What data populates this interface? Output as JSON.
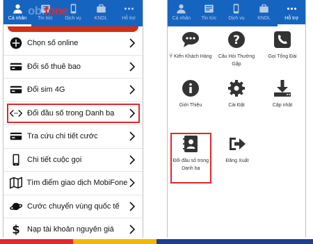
{
  "colors": {
    "nav_bg": "#1565c0",
    "highlight": "#e0262a",
    "menu_strip": "#d42e12",
    "icon": "#333333",
    "text": "#111111"
  },
  "logo": {
    "part1": "obi",
    "part2": "fone"
  },
  "left_screen": {
    "tabs": [
      {
        "label": "Cá nhân",
        "icon": "person-icon",
        "active": true
      },
      {
        "label": "Tin tức",
        "icon": "news-icon",
        "active": false
      },
      {
        "label": "Dịch vụ",
        "icon": "phone-icon",
        "active": false
      },
      {
        "label": "KNDL",
        "icon": "briefcase-icon",
        "active": false
      },
      {
        "label": "Hỗ trợ",
        "icon": "more-icon",
        "active": false
      }
    ],
    "menu": [
      {
        "label": "Chọn số online",
        "icon": "plus-circle-icon",
        "highlighted": false
      },
      {
        "label": "Đổi số thuê bao",
        "icon": "card-icon",
        "highlighted": false
      },
      {
        "label": "Đổi sim 4G",
        "icon": "card-icon",
        "highlighted": false
      },
      {
        "label": "Đổi đầu số trong Danh bạ",
        "icon": "code-arrows-icon",
        "highlighted": true
      },
      {
        "label": "Tra cứu chi tiết cước",
        "icon": "card-icon",
        "highlighted": false
      },
      {
        "label": "Chi tiết cuộc gọi",
        "icon": "mobile-icon",
        "highlighted": false
      },
      {
        "label": "Tìm điểm giao dịch MobiFone",
        "icon": "map-icon",
        "highlighted": false
      },
      {
        "label": "Cước chuyển vùng quốc tế",
        "icon": "planet-icon",
        "highlighted": false
      },
      {
        "label": "Nạp tài khoản nguyên giá",
        "icon": "dollar-icon",
        "highlighted": false
      }
    ]
  },
  "right_screen": {
    "tabs": [
      {
        "label": "Cá nhân",
        "icon": "person-icon",
        "active": false
      },
      {
        "label": "Tin tức",
        "icon": "news-icon",
        "active": false
      },
      {
        "label": "Dịch vụ",
        "icon": "phone-icon",
        "active": false
      },
      {
        "label": "KNDL",
        "icon": "briefcase-icon",
        "active": false
      },
      {
        "label": "Hỗ trợ",
        "icon": "more-icon",
        "active": true
      }
    ],
    "grid": [
      {
        "label": "Ý Kiến Khách Hàng",
        "icon": "chat-icon",
        "highlighted": false
      },
      {
        "label": "Câu Hỏi Thường Gặp",
        "icon": "question-icon",
        "highlighted": false
      },
      {
        "label": "Gọi Tổng Đài",
        "icon": "phone-call-icon",
        "highlighted": false
      },
      {
        "label": "Giới Thiệu",
        "icon": "info-icon",
        "highlighted": false
      },
      {
        "label": "Cài Đặt",
        "icon": "gear-icon",
        "highlighted": false
      },
      {
        "label": "Cập nhật",
        "icon": "download-icon",
        "highlighted": false
      },
      {
        "label": "Đổi đầu số trong Danh bạ",
        "icon": "contacts-book-icon",
        "highlighted": true
      },
      {
        "label": "Đăng Xuất",
        "icon": "logout-icon",
        "highlighted": false
      }
    ]
  }
}
